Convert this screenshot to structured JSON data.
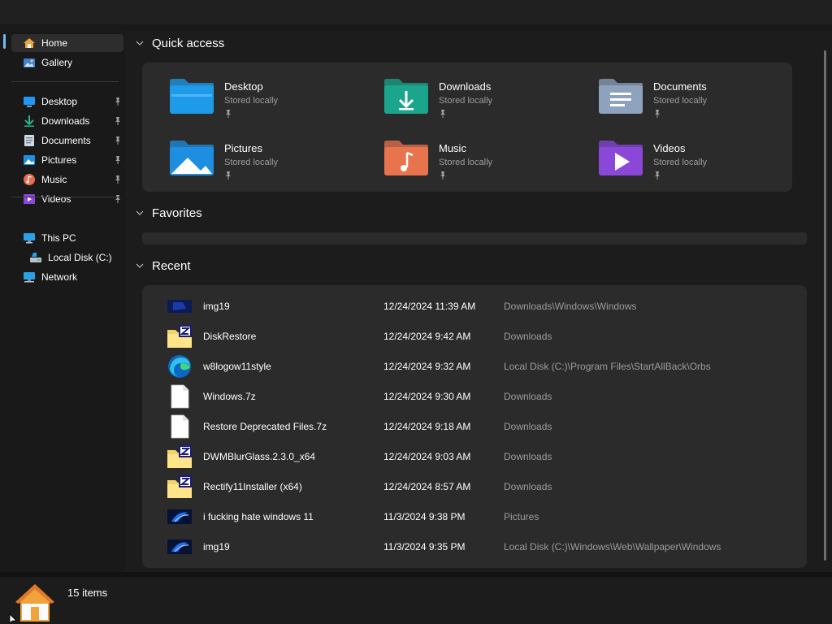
{
  "sidebar": {
    "groups": [
      [
        {
          "label": "Home",
          "icon": "home-icon",
          "selected": true
        },
        {
          "label": "Gallery",
          "icon": "gallery-icon"
        }
      ],
      [
        {
          "label": "Desktop",
          "icon": "desktop-icon",
          "pinned": true
        },
        {
          "label": "Downloads",
          "icon": "downloads-icon",
          "pinned": true
        },
        {
          "label": "Documents",
          "icon": "documents-icon",
          "pinned": true
        },
        {
          "label": "Pictures",
          "icon": "pictures-icon",
          "pinned": true
        },
        {
          "label": "Music",
          "icon": "music-icon",
          "pinned": true
        },
        {
          "label": "Videos",
          "icon": "videos-icon",
          "pinned": true
        }
      ],
      [
        {
          "label": "This PC",
          "icon": "this-pc-icon"
        },
        {
          "label": "Local Disk (C:)",
          "icon": "local-disk-icon",
          "indent": true
        },
        {
          "label": "Network",
          "icon": "network-icon"
        }
      ]
    ]
  },
  "quick_access": {
    "title": "Quick access",
    "items": [
      {
        "name": "Desktop",
        "sub": "Stored locally",
        "icon": "desktop-folder-icon",
        "color": "#1e9be8"
      },
      {
        "name": "Downloads",
        "sub": "Stored locally",
        "icon": "downloads-folder-icon",
        "color": "#1aa58c"
      },
      {
        "name": "Documents",
        "sub": "Stored locally",
        "icon": "documents-folder-icon",
        "color": "#8fa2bd"
      },
      {
        "name": "Pictures",
        "sub": "Stored locally",
        "icon": "pictures-folder-icon",
        "color": "#1e8fe0"
      },
      {
        "name": "Music",
        "sub": "Stored locally",
        "icon": "music-folder-icon",
        "color": "#e8744e"
      },
      {
        "name": "Videos",
        "sub": "Stored locally",
        "icon": "videos-folder-icon",
        "color": "#8b48d8"
      }
    ]
  },
  "favorites": {
    "title": "Favorites"
  },
  "recent": {
    "title": "Recent",
    "rows": [
      {
        "name": "img19",
        "date": "12/24/2024 11:39 AM",
        "location": "Downloads\\Windows\\Windows",
        "icon": "image-thumbnail-icon"
      },
      {
        "name": "DiskRestore",
        "date": "12/24/2024 9:42 AM",
        "location": "Downloads",
        "icon": "zip-folder-icon"
      },
      {
        "name": "w8logow11style",
        "date": "12/24/2024 9:32 AM",
        "location": "Local Disk (C:)\\Program Files\\StartAllBack\\Orbs",
        "icon": "edge-icon"
      },
      {
        "name": "Windows.7z",
        "date": "12/24/2024 9:30 AM",
        "location": "Downloads",
        "icon": "file-icon"
      },
      {
        "name": "Restore Deprecated Files.7z",
        "date": "12/24/2024 9:18 AM",
        "location": "Downloads",
        "icon": "file-icon"
      },
      {
        "name": "DWMBlurGlass.2.3.0_x64",
        "date": "12/24/2024 9:03 AM",
        "location": "Downloads",
        "icon": "zip-folder-icon"
      },
      {
        "name": "Rectify11Installer (x64)",
        "date": "12/24/2024 8:57 AM",
        "location": "Downloads",
        "icon": "zip-folder-icon"
      },
      {
        "name": "i fucking hate windows 11",
        "date": "11/3/2024 9:38 PM",
        "location": "Pictures",
        "icon": "wallpaper-thumbnail-icon"
      },
      {
        "name": "img19",
        "date": "11/3/2024 9:35 PM",
        "location": "Local Disk (C:)\\Windows\\Web\\Wallpaper\\Windows",
        "icon": "wallpaper-thumbnail-icon"
      }
    ]
  },
  "status": {
    "count": "15 items"
  },
  "colors": {
    "background": "#1c1c1c",
    "panel": "#2b2b2b",
    "accent": "#76b9ed"
  }
}
